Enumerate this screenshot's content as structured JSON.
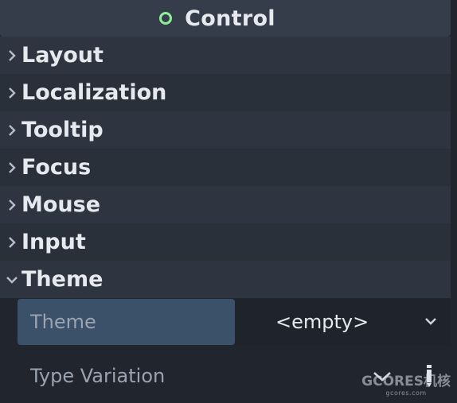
{
  "header": {
    "title": "Control",
    "icon": "circle-node-icon",
    "icon_color": "#8eef97"
  },
  "sections": [
    {
      "label": "Layout",
      "expanded": false
    },
    {
      "label": "Localization",
      "expanded": false
    },
    {
      "label": "Tooltip",
      "expanded": false
    },
    {
      "label": "Focus",
      "expanded": false
    },
    {
      "label": "Mouse",
      "expanded": false
    },
    {
      "label": "Input",
      "expanded": false
    },
    {
      "label": "Theme",
      "expanded": true
    }
  ],
  "theme_props": {
    "theme": {
      "label": "Theme",
      "value": "<empty>"
    },
    "type_variation": {
      "label": "Type Variation"
    }
  },
  "watermark": {
    "main": "GCORES机核",
    "sub": "gcores.com"
  }
}
